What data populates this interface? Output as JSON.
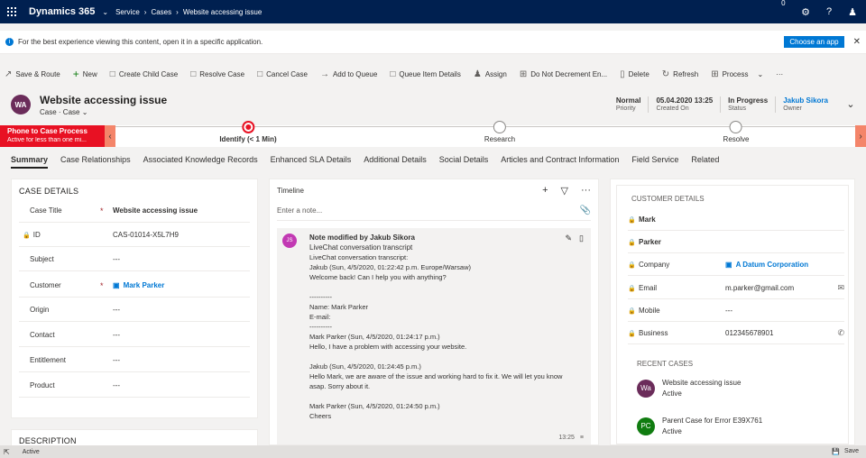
{
  "topnav": {
    "app_name": "Dynamics 365",
    "breadcrumbs": [
      "Service",
      "Cases",
      "Website accessing issue"
    ],
    "notification_count": "0"
  },
  "banner": {
    "text": "For the best experience viewing this content, open it in a specific application.",
    "button": "Choose an app"
  },
  "commands": [
    {
      "label": "Save & Route",
      "icon": "route-icon"
    },
    {
      "label": "New",
      "icon": "plus-icon"
    },
    {
      "label": "Create Child Case",
      "icon": "document-icon"
    },
    {
      "label": "Resolve Case",
      "icon": "document-icon"
    },
    {
      "label": "Cancel Case",
      "icon": "document-icon"
    },
    {
      "label": "Add to Queue",
      "icon": "arrow-right-icon"
    },
    {
      "label": "Queue Item Details",
      "icon": "document-icon"
    },
    {
      "label": "Assign",
      "icon": "person-icon"
    },
    {
      "label": "Do Not Decrement En...",
      "icon": "grid-icon"
    },
    {
      "label": "Delete",
      "icon": "trash-icon"
    },
    {
      "label": "Refresh",
      "icon": "refresh-icon"
    },
    {
      "label": "Process",
      "icon": "process-icon"
    }
  ],
  "record": {
    "initials": "WA",
    "title": "Website accessing issue",
    "subtitle": "Case · Case",
    "fields": [
      {
        "value": "Normal",
        "label": "Priority"
      },
      {
        "value": "05.04.2020 13:25",
        "label": "Created On"
      },
      {
        "value": "In Progress",
        "label": "Status"
      },
      {
        "value": "Jakub Sikora",
        "label": "Owner"
      }
    ]
  },
  "process": {
    "name": "Phone to Case Process",
    "duration": "Active for less than one mi...",
    "stages": [
      {
        "label": "Identify  (< 1 Min)",
        "active": true
      },
      {
        "label": "Research",
        "active": false
      },
      {
        "label": "Resolve",
        "active": false
      }
    ]
  },
  "tabs": [
    "Summary",
    "Case Relationships",
    "Associated Knowledge Records",
    "Enhanced SLA Details",
    "Additional Details",
    "Social Details",
    "Articles and Contract Information",
    "Field Service",
    "Related"
  ],
  "case_details": {
    "title": "CASE DETAILS",
    "rows": [
      {
        "label": "Case Title",
        "value": "Website accessing issue",
        "required": "*"
      },
      {
        "label": "ID",
        "value": "CAS-01014-X5L7H9",
        "required": ""
      },
      {
        "label": "Subject",
        "value": "---",
        "required": ""
      },
      {
        "label": "Customer",
        "value": "Mark Parker",
        "required": "*"
      },
      {
        "label": "Origin",
        "value": "---",
        "required": ""
      },
      {
        "label": "Contact",
        "value": "---",
        "required": ""
      },
      {
        "label": "Entitlement",
        "value": "---",
        "required": ""
      },
      {
        "label": "Product",
        "value": "---",
        "required": ""
      }
    ]
  },
  "description": {
    "title": "DESCRIPTION"
  },
  "timeline": {
    "title": "Timeline",
    "placeholder": "Enter a note...",
    "note": {
      "initials": "JS",
      "title": "Note modified by Jakub Sikora",
      "subtitle": "LiveChat conversation transcript",
      "body": "LiveChat conversation transcript:\nJakub (Sun, 4/5/2020, 01:22:42 p.m. Europe/Warsaw)\nWelcome back! Can I help you with anything?\n\n----------\nName: Mark Parker\nE-mail:\n----------\nMark Parker (Sun, 4/5/2020, 01:24:17 p.m.)\nHello, I have a problem with accessing your website.\n\nJakub (Sun, 4/5/2020, 01:24:45 p.m.)\nHello Mark, we are aware of the issue and working hard to fix it. We will let you know\nasap. Sorry about it.\n\nMark Parker (Sun, 4/5/2020, 01:24:50 p.m.)\nCheers",
      "time": "13:25"
    }
  },
  "customer": {
    "title": "CUSTOMER DETAILS",
    "rows": [
      {
        "label": "",
        "value": "Mark",
        "lock": true
      },
      {
        "label": "",
        "value": "Parker",
        "lock": true
      },
      {
        "label": "Company",
        "value": "A Datum Corporation",
        "lock": true
      },
      {
        "label": "Email",
        "value": "m.parker@gmail.com",
        "lock": true
      },
      {
        "label": "Mobile",
        "value": "---",
        "lock": true
      },
      {
        "label": "Business",
        "value": "012345678901",
        "lock": true
      }
    ],
    "recent_title": "RECENT CASES",
    "recent": [
      {
        "initials": "Wa",
        "title": "Website accessing issue",
        "status": "Active",
        "color": "#6b2c5a"
      },
      {
        "initials": "PC",
        "title": "Parent Case for Error E39X761",
        "status": "Active",
        "color": "#107c10"
      }
    ]
  },
  "statusbar": {
    "status": "Active",
    "save": "Save"
  },
  "colors": {
    "nav": "#002050",
    "accent": "#0078d4",
    "process_flag": "#e81123"
  }
}
